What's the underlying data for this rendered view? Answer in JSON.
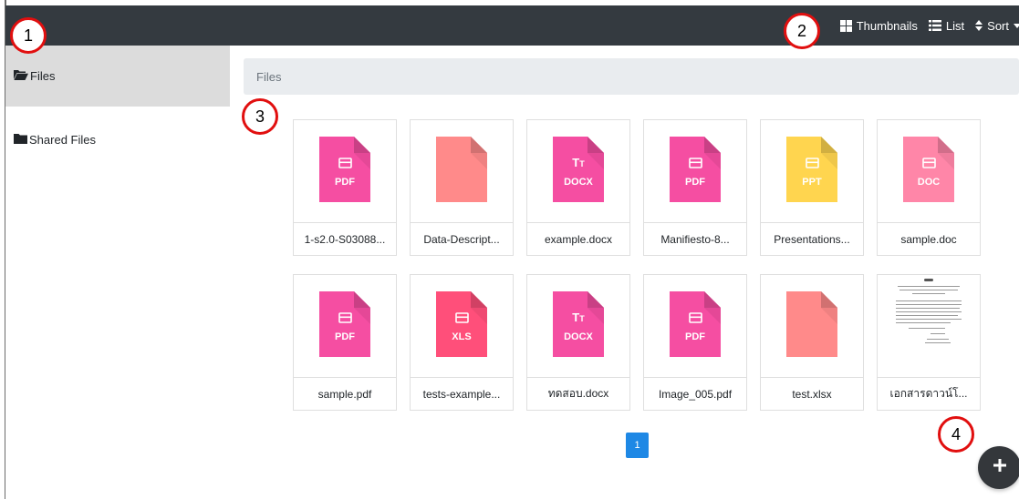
{
  "toolbar": {
    "thumbnails_label": "Thumbnails",
    "list_label": "List",
    "sort_label": "Sort"
  },
  "sidebar": {
    "items": [
      {
        "label": "Files",
        "icon": "folder-open-icon",
        "active": true
      },
      {
        "label": "Shared Files",
        "icon": "folder-icon",
        "active": false
      }
    ]
  },
  "breadcrumb": {
    "label": "Files"
  },
  "files": [
    {
      "name": "1-s2.0-S03088...",
      "type": "PDF",
      "color": "#f54ea2",
      "icon": "file-pdf-icon"
    },
    {
      "name": "Data-Descript...",
      "type": "",
      "color": "#ff8a8a",
      "icon": "file-icon"
    },
    {
      "name": "example.docx",
      "type": "DOCX",
      "color": "#f54ea2",
      "icon": "file-docx-icon"
    },
    {
      "name": "Manifiesto-8...",
      "type": "PDF",
      "color": "#f54ea2",
      "icon": "file-pdf-icon"
    },
    {
      "name": "Presentations...",
      "type": "PPT",
      "color": "#ffd54f",
      "icon": "file-ppt-icon"
    },
    {
      "name": "sample.doc",
      "type": "DOC",
      "color": "#ff86a8",
      "icon": "file-doc-icon"
    },
    {
      "name": "sample.pdf",
      "type": "PDF",
      "color": "#f54ea2",
      "icon": "file-pdf-icon"
    },
    {
      "name": "tests-example...",
      "type": "XLS",
      "color": "#ff4f7a",
      "icon": "file-xls-icon"
    },
    {
      "name": "ทดสอบ.docx",
      "type": "DOCX",
      "color": "#f54ea2",
      "icon": "file-docx-icon"
    },
    {
      "name": "Image_005.pdf",
      "type": "PDF",
      "color": "#f54ea2",
      "icon": "file-pdf-icon"
    },
    {
      "name": "test.xlsx",
      "type": "",
      "color": "#ff8a8a",
      "icon": "file-icon"
    },
    {
      "name": "เอกสารดาวน์โ...",
      "type": "",
      "color": "",
      "icon": "document-preview-icon"
    }
  ],
  "pagination": {
    "current_page": "1"
  },
  "fab": {
    "icon": "plus-icon"
  },
  "annotations": [
    "1",
    "2",
    "3",
    "4"
  ],
  "colors": {
    "topbar": "#343a40",
    "active_sidebar": "#dcdcdc",
    "breadcrumb_bg": "#e9ecef",
    "pager": "#1e88e5",
    "badge_border": "#e10f0f"
  }
}
